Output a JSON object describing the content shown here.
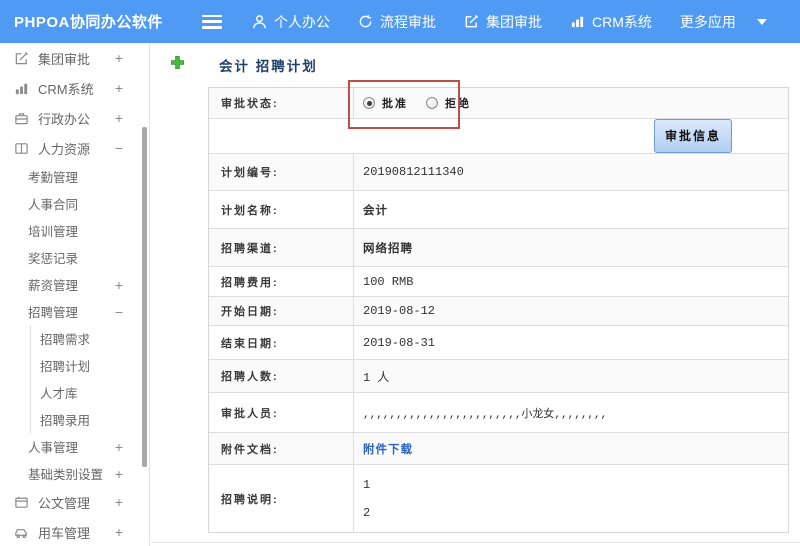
{
  "colors": {
    "navbar_blue": "#4f9bf3",
    "annotation_red": "#bd4e4c",
    "link_blue": "#2a65c0",
    "title_navy": "#1f4068",
    "button_face": "#b2cef1",
    "button_border": "#6f9bd1"
  },
  "navbar": {
    "brand": "PHPOA协同办公软件",
    "items": [
      {
        "icon": "user-icon",
        "label": "个人办公"
      },
      {
        "icon": "process-icon",
        "label": "流程审批"
      },
      {
        "icon": "edit-icon",
        "label": "集团审批"
      },
      {
        "icon": "chart-icon",
        "label": "CRM系统"
      },
      {
        "icon": "more-icon",
        "label": "更多应用"
      }
    ]
  },
  "sidebar": {
    "items": [
      {
        "label": "集团审批",
        "level": 1,
        "icon": "edit-square-icon",
        "expand": "+"
      },
      {
        "label": "CRM系统",
        "level": 1,
        "icon": "bar-chart-icon",
        "expand": "+"
      },
      {
        "label": "行政办公",
        "level": 1,
        "icon": "briefcase-icon",
        "expand": "+"
      },
      {
        "label": "人力资源",
        "level": 1,
        "icon": "book-icon",
        "expand": "−"
      },
      {
        "label": "考勤管理",
        "level": 2,
        "expand": ""
      },
      {
        "label": "人事合同",
        "level": 2,
        "expand": ""
      },
      {
        "label": "培训管理",
        "level": 2,
        "expand": ""
      },
      {
        "label": "奖惩记录",
        "level": 2,
        "expand": ""
      },
      {
        "label": "薪资管理",
        "level": 2,
        "expand": "+"
      },
      {
        "label": "招聘管理",
        "level": 2,
        "expand": "−"
      },
      {
        "label": "招聘需求",
        "level": 3,
        "expand": ""
      },
      {
        "label": "招聘计划",
        "level": 3,
        "expand": ""
      },
      {
        "label": "人才库",
        "level": 3,
        "expand": ""
      },
      {
        "label": "招聘录用",
        "level": 3,
        "expand": ""
      },
      {
        "label": "人事管理",
        "level": 2,
        "expand": "+"
      },
      {
        "label": "基础类别设置",
        "level": 2,
        "expand": "+"
      },
      {
        "label": "公文管理",
        "level": 1,
        "icon": "document-icon",
        "expand": "+"
      },
      {
        "label": "用车管理",
        "level": 1,
        "icon": "car-icon",
        "expand": "+"
      }
    ]
  },
  "main": {
    "title": "会计 招聘计划",
    "title_icon": "add-plus-icon",
    "form": {
      "status_row": {
        "label": "审批状态:",
        "options": [
          {
            "label": "批准",
            "selected": true
          },
          {
            "label": "拒绝",
            "selected": false
          }
        ]
      },
      "approval_button": "审批信息",
      "rows": [
        {
          "label": "计划编号:",
          "value": "20190812111340"
        },
        {
          "label": "计划名称:",
          "value": "会计"
        },
        {
          "label": "招聘渠道:",
          "value": "网络招聘"
        },
        {
          "label": "招聘费用:",
          "value": "100 RMB"
        },
        {
          "label": "开始日期:",
          "value": "2019-08-12"
        },
        {
          "label": "结束日期:",
          "value": "2019-08-31"
        },
        {
          "label": "招聘人数:",
          "value": "1 人"
        },
        {
          "label": "审批人员:",
          "value": ",,,,,,,,,,,,,,,,,,,,,,,,小龙女,,,,,,,,"
        },
        {
          "label": "附件文档:",
          "value": "附件下载",
          "type": "link"
        },
        {
          "label": "招聘说明:",
          "lines": [
            "1",
            "2"
          ]
        }
      ]
    }
  }
}
